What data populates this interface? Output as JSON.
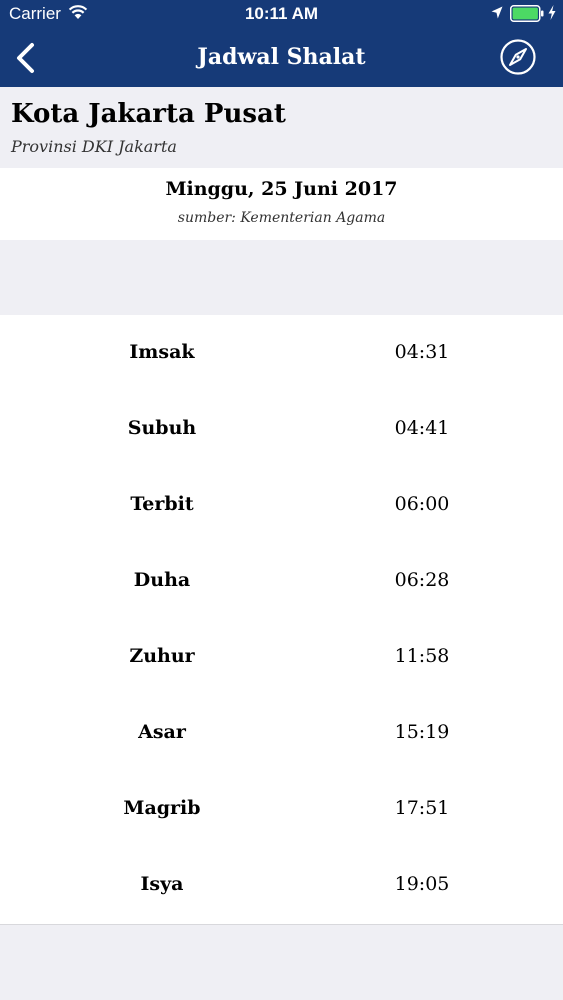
{
  "status_bar": {
    "carrier": "Carrier",
    "time": "10:11 AM"
  },
  "nav": {
    "title": "Jadwal Shalat",
    "back_icon": "chevron-left-icon",
    "compass_icon": "compass-icon",
    "background": "#163a78"
  },
  "location": {
    "city": "Kota Jakarta Pusat",
    "province": "Provinsi DKI Jakarta"
  },
  "date": {
    "text": "Minggu, 25 Juni 2017",
    "source": "sumber: Kementerian Agama"
  },
  "prayers": [
    {
      "name": "Imsak",
      "time": "04:31"
    },
    {
      "name": "Subuh",
      "time": "04:41"
    },
    {
      "name": "Terbit",
      "time": "06:00"
    },
    {
      "name": "Duha",
      "time": "06:28"
    },
    {
      "name": "Zuhur",
      "time": "11:58"
    },
    {
      "name": "Asar",
      "time": "15:19"
    },
    {
      "name": "Magrib",
      "time": "17:51"
    },
    {
      "name": "Isya",
      "time": "19:05"
    }
  ]
}
